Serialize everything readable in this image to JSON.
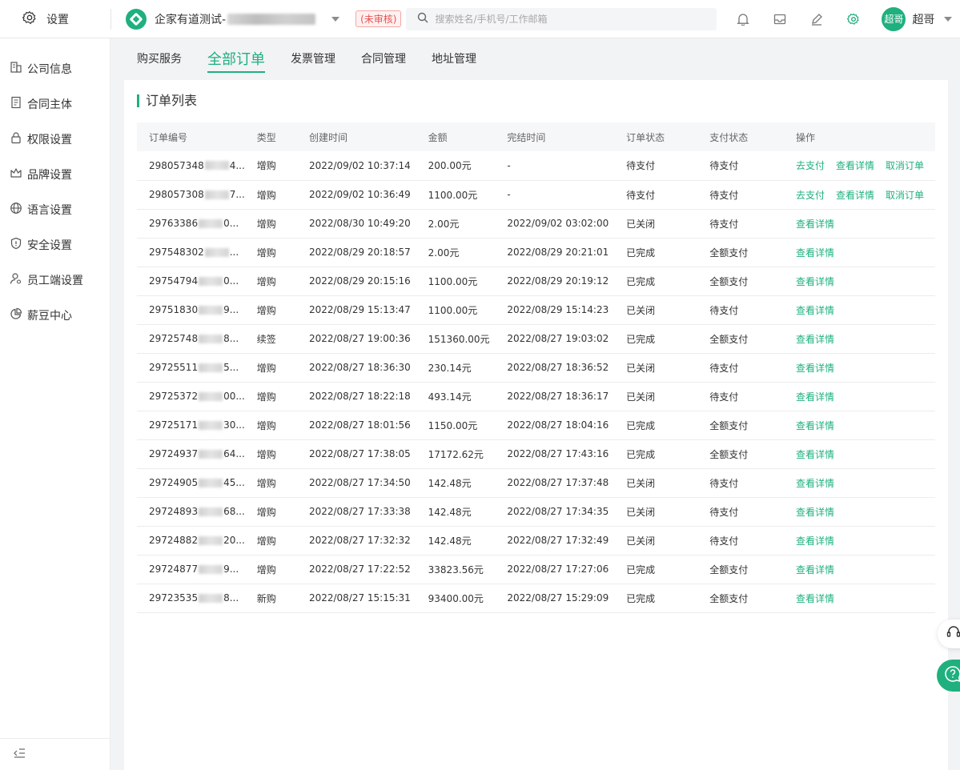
{
  "header": {
    "settings_label": "设置",
    "org_name": "企家有道测试-",
    "org_status": "(未审核)",
    "search_placeholder": "搜索姓名/手机号/工作邮箱",
    "user_avatar_text": "超哥",
    "user_name": "超哥",
    "accent_color": "#1fb07e"
  },
  "sidebar": {
    "items": [
      {
        "label": "公司信息",
        "icon": "building-icon"
      },
      {
        "label": "合同主体",
        "icon": "document-icon"
      },
      {
        "label": "权限设置",
        "icon": "lock-icon"
      },
      {
        "label": "品牌设置",
        "icon": "crown-icon"
      },
      {
        "label": "语言设置",
        "icon": "globe-icon"
      },
      {
        "label": "安全设置",
        "icon": "shield-icon"
      },
      {
        "label": "员工端设置",
        "icon": "person-icon"
      },
      {
        "label": "薪豆中心",
        "icon": "pie-icon"
      }
    ]
  },
  "tabs": [
    "购买服务",
    "全部订单",
    "发票管理",
    "合同管理",
    "地址管理"
  ],
  "active_tab": "全部订单",
  "card": {
    "title": "订单列表"
  },
  "table": {
    "columns": [
      "订单编号",
      "类型",
      "创建时间",
      "金额",
      "完结时间",
      "订单状态",
      "支付状态",
      "操作"
    ],
    "rows": [
      {
        "id_prefix": "298057348",
        "id_suffix": "4...",
        "type": "增购",
        "created": "2022/09/02 10:37:14",
        "amount": "200.00元",
        "finished": "-",
        "status": "待支付",
        "pay": "待支付",
        "actions": [
          "去支付",
          "查看详情",
          "取消订单"
        ]
      },
      {
        "id_prefix": "298057308",
        "id_suffix": "7...",
        "type": "增购",
        "created": "2022/09/02 10:36:49",
        "amount": "1100.00元",
        "finished": "-",
        "status": "待支付",
        "pay": "待支付",
        "actions": [
          "去支付",
          "查看详情",
          "取消订单"
        ]
      },
      {
        "id_prefix": "29763386",
        "id_suffix": "0...",
        "type": "增购",
        "created": "2022/08/30 10:49:20",
        "amount": "2.00元",
        "finished": "2022/09/02 03:02:00",
        "status": "已关闭",
        "pay": "待支付",
        "actions": [
          "查看详情"
        ]
      },
      {
        "id_prefix": "297548302",
        "id_suffix": "...",
        "type": "增购",
        "created": "2022/08/29 20:18:57",
        "amount": "2.00元",
        "finished": "2022/08/29 20:21:01",
        "status": "已完成",
        "pay": "全额支付",
        "actions": [
          "查看详情"
        ]
      },
      {
        "id_prefix": "29754794",
        "id_suffix": "0...",
        "type": "增购",
        "created": "2022/08/29 20:15:16",
        "amount": "1100.00元",
        "finished": "2022/08/29 20:19:12",
        "status": "已完成",
        "pay": "全额支付",
        "actions": [
          "查看详情"
        ]
      },
      {
        "id_prefix": "29751830",
        "id_suffix": "9...",
        "type": "增购",
        "created": "2022/08/29 15:13:47",
        "amount": "1100.00元",
        "finished": "2022/08/29 15:14:23",
        "status": "已关闭",
        "pay": "待支付",
        "actions": [
          "查看详情"
        ]
      },
      {
        "id_prefix": "29725748",
        "id_suffix": "8...",
        "type": "续签",
        "created": "2022/08/27 19:00:36",
        "amount": "151360.00元",
        "finished": "2022/08/27 19:03:02",
        "status": "已完成",
        "pay": "全额支付",
        "actions": [
          "查看详情"
        ]
      },
      {
        "id_prefix": "29725511",
        "id_suffix": "5...",
        "type": "增购",
        "created": "2022/08/27 18:36:30",
        "amount": "230.14元",
        "finished": "2022/08/27 18:36:52",
        "status": "已关闭",
        "pay": "待支付",
        "actions": [
          "查看详情"
        ]
      },
      {
        "id_prefix": "29725372",
        "id_suffix": "00...",
        "type": "增购",
        "created": "2022/08/27 18:22:18",
        "amount": "493.14元",
        "finished": "2022/08/27 18:36:17",
        "status": "已关闭",
        "pay": "待支付",
        "actions": [
          "查看详情"
        ]
      },
      {
        "id_prefix": "29725171",
        "id_suffix": "30...",
        "type": "增购",
        "created": "2022/08/27 18:01:56",
        "amount": "1150.00元",
        "finished": "2022/08/27 18:04:16",
        "status": "已完成",
        "pay": "全额支付",
        "actions": [
          "查看详情"
        ]
      },
      {
        "id_prefix": "29724937",
        "id_suffix": "64...",
        "type": "增购",
        "created": "2022/08/27 17:38:05",
        "amount": "17172.62元",
        "finished": "2022/08/27 17:43:16",
        "status": "已完成",
        "pay": "全额支付",
        "actions": [
          "查看详情"
        ]
      },
      {
        "id_prefix": "29724905",
        "id_suffix": "45...",
        "type": "增购",
        "created": "2022/08/27 17:34:50",
        "amount": "142.48元",
        "finished": "2022/08/27 17:37:48",
        "status": "已关闭",
        "pay": "待支付",
        "actions": [
          "查看详情"
        ]
      },
      {
        "id_prefix": "29724893",
        "id_suffix": "68...",
        "type": "增购",
        "created": "2022/08/27 17:33:38",
        "amount": "142.48元",
        "finished": "2022/08/27 17:34:35",
        "status": "已关闭",
        "pay": "待支付",
        "actions": [
          "查看详情"
        ]
      },
      {
        "id_prefix": "29724882",
        "id_suffix": "20...",
        "type": "增购",
        "created": "2022/08/27 17:32:32",
        "amount": "142.48元",
        "finished": "2022/08/27 17:32:49",
        "status": "已关闭",
        "pay": "待支付",
        "actions": [
          "查看详情"
        ]
      },
      {
        "id_prefix": "29724877",
        "id_suffix": "9...",
        "type": "增购",
        "created": "2022/08/27 17:22:52",
        "amount": "33823.56元",
        "finished": "2022/08/27 17:27:06",
        "status": "已完成",
        "pay": "全额支付",
        "actions": [
          "查看详情"
        ]
      },
      {
        "id_prefix": "29723535",
        "id_suffix": "8...",
        "type": "新购",
        "created": "2022/08/27 15:15:31",
        "amount": "93400.00元",
        "finished": "2022/08/27 15:29:09",
        "status": "已完成",
        "pay": "全额支付",
        "actions": [
          "查看详情"
        ]
      }
    ]
  }
}
